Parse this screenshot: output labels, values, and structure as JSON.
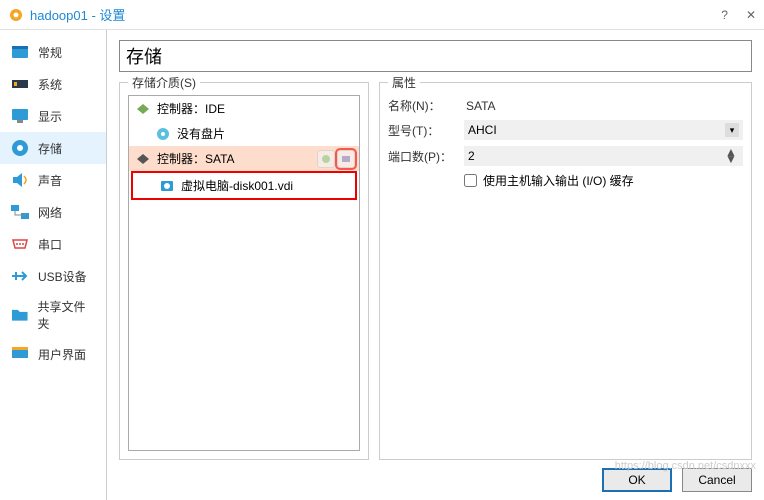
{
  "window": {
    "title": "hadoop01 - 设置"
  },
  "sidebar": {
    "items": [
      {
        "label": "常规"
      },
      {
        "label": "系统"
      },
      {
        "label": "显示"
      },
      {
        "label": "存储"
      },
      {
        "label": "声音"
      },
      {
        "label": "网络"
      },
      {
        "label": "串口"
      },
      {
        "label": "USB设备"
      },
      {
        "label": "共享文件夹"
      },
      {
        "label": "用户界面"
      }
    ]
  },
  "main": {
    "title": "存储",
    "storageLegend": "存储介质(S)",
    "attrLegend": "属性",
    "tree": {
      "ide": {
        "label": "控制器：IDE",
        "child": "没有盘片"
      },
      "sata": {
        "label": "控制器：SATA",
        "child": "虚拟电脑-disk001.vdi"
      }
    },
    "attrs": {
      "nameLabel": "名称(N)：",
      "nameValue": "SATA",
      "typeLabel": "型号(T)：",
      "typeValue": "AHCI",
      "portLabel": "端口数(P)：",
      "portValue": "2",
      "ioLabel": "使用主机输入输出 (I/O) 缓存"
    }
  },
  "footer": {
    "ok": "OK",
    "cancel": "Cancel"
  },
  "watermark": "https://blog.csdn.net/csdnxxx"
}
